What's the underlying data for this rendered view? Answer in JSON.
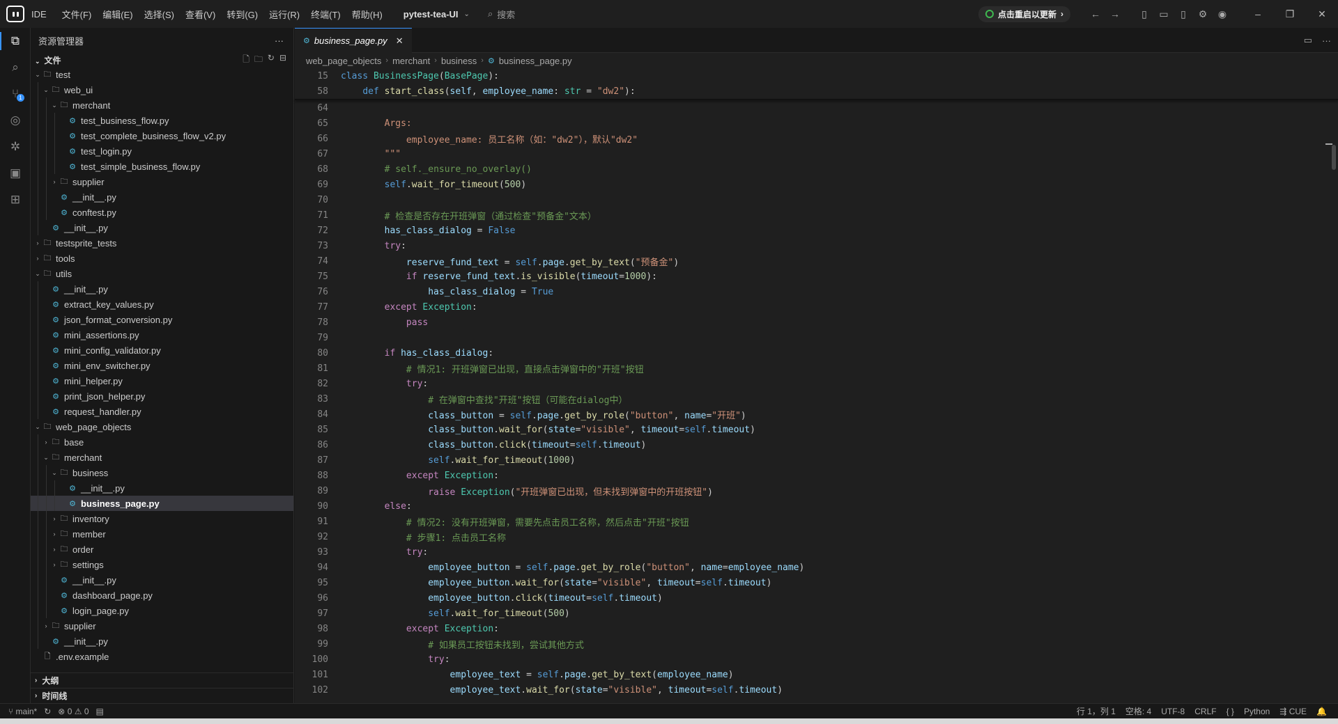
{
  "titlebar": {
    "app_name": "IDE",
    "menus": [
      "文件(F)",
      "编辑(E)",
      "选择(S)",
      "查看(V)",
      "转到(G)",
      "运行(R)",
      "终端(T)",
      "帮助(H)"
    ],
    "project": "pytest-tea-UI",
    "search_placeholder": "搜索",
    "restart_label": "点击重启以更新"
  },
  "sidebar": {
    "title": "资源管理器",
    "section": "文件",
    "tree": [
      {
        "label": "test",
        "depth": 0,
        "kind": "folder",
        "open": true
      },
      {
        "label": "web_ui",
        "depth": 1,
        "kind": "folder",
        "open": true
      },
      {
        "label": "merchant",
        "depth": 2,
        "kind": "folder",
        "open": true
      },
      {
        "label": "test_business_flow.py",
        "depth": 3,
        "kind": "py"
      },
      {
        "label": "test_complete_business_flow_v2.py",
        "depth": 3,
        "kind": "py"
      },
      {
        "label": "test_login.py",
        "depth": 3,
        "kind": "py"
      },
      {
        "label": "test_simple_business_flow.py",
        "depth": 3,
        "kind": "py"
      },
      {
        "label": "supplier",
        "depth": 2,
        "kind": "folder",
        "open": false
      },
      {
        "label": "__init__.py",
        "depth": 2,
        "kind": "py"
      },
      {
        "label": "conftest.py",
        "depth": 2,
        "kind": "py"
      },
      {
        "label": "__init__.py",
        "depth": 1,
        "kind": "py"
      },
      {
        "label": "testsprite_tests",
        "depth": 0,
        "kind": "folder",
        "open": false
      },
      {
        "label": "tools",
        "depth": 0,
        "kind": "folder",
        "open": false
      },
      {
        "label": "utils",
        "depth": 0,
        "kind": "folder",
        "open": true
      },
      {
        "label": "__init__.py",
        "depth": 1,
        "kind": "py"
      },
      {
        "label": "extract_key_values.py",
        "depth": 1,
        "kind": "py"
      },
      {
        "label": "json_format_conversion.py",
        "depth": 1,
        "kind": "py"
      },
      {
        "label": "mini_assertions.py",
        "depth": 1,
        "kind": "py"
      },
      {
        "label": "mini_config_validator.py",
        "depth": 1,
        "kind": "py"
      },
      {
        "label": "mini_env_switcher.py",
        "depth": 1,
        "kind": "py"
      },
      {
        "label": "mini_helper.py",
        "depth": 1,
        "kind": "py"
      },
      {
        "label": "print_json_helper.py",
        "depth": 1,
        "kind": "py"
      },
      {
        "label": "request_handler.py",
        "depth": 1,
        "kind": "py"
      },
      {
        "label": "web_page_objects",
        "depth": 0,
        "kind": "folder",
        "open": true
      },
      {
        "label": "base",
        "depth": 1,
        "kind": "folder",
        "open": false
      },
      {
        "label": "merchant",
        "depth": 1,
        "kind": "folder",
        "open": true
      },
      {
        "label": "business",
        "depth": 2,
        "kind": "folder",
        "open": true
      },
      {
        "label": "__init__.py",
        "depth": 3,
        "kind": "py"
      },
      {
        "label": "business_page.py",
        "depth": 3,
        "kind": "py",
        "selected": true
      },
      {
        "label": "inventory",
        "depth": 2,
        "kind": "folder",
        "open": false
      },
      {
        "label": "member",
        "depth": 2,
        "kind": "folder",
        "open": false
      },
      {
        "label": "order",
        "depth": 2,
        "kind": "folder",
        "open": false
      },
      {
        "label": "settings",
        "depth": 2,
        "kind": "folder",
        "open": false
      },
      {
        "label": "__init__.py",
        "depth": 2,
        "kind": "py"
      },
      {
        "label": "dashboard_page.py",
        "depth": 2,
        "kind": "py"
      },
      {
        "label": "login_page.py",
        "depth": 2,
        "kind": "py"
      },
      {
        "label": "supplier",
        "depth": 1,
        "kind": "folder",
        "open": false
      },
      {
        "label": "__init__.py",
        "depth": 1,
        "kind": "py"
      },
      {
        "label": ".env.example",
        "depth": 0,
        "kind": "file"
      }
    ],
    "outline_label": "大纲",
    "timeline_label": "时间线"
  },
  "editor": {
    "tab_label": "business_page.py",
    "breadcrumbs": [
      "web_page_objects",
      "merchant",
      "business",
      "business_page.py"
    ],
    "sticky": [
      {
        "n": "15",
        "html": "<span class='kb'>class</span> <span class='cl'>BusinessPage</span>(<span class='cl'>BasePage</span>):"
      },
      {
        "n": "58",
        "html": "    <span class='kb'>def</span> <span class='f'>start_class</span>(<span class='p'>self</span>, <span class='p'>employee_name</span>: <span class='cl'>str</span> = <span class='s2'>\"dw2\"</span>):"
      }
    ],
    "lines": [
      {
        "n": "64",
        "html": ""
      },
      {
        "n": "65",
        "html": "        <span class='s2'>Args:</span>"
      },
      {
        "n": "66",
        "html": "            <span class='s2'>employee_name: 员工名称（如：\"dw2\"），默认\"dw2\"</span>"
      },
      {
        "n": "67",
        "html": "        <span class='s2'>\"\"\"</span>"
      },
      {
        "n": "68",
        "html": "        <span class='cm'># self._ensure_no_overlay()</span>"
      },
      {
        "n": "69",
        "html": "        <span class='sf'>self</span>.<span class='f'>wait_for_timeout</span>(<span class='n'>500</span>)"
      },
      {
        "n": "70",
        "html": ""
      },
      {
        "n": "71",
        "html": "        <span class='cm'># 检查是否存在开班弹窗（通过检查\"预备金\"文本）</span>"
      },
      {
        "n": "72",
        "html": "        <span class='p'>has_class_dialog</span> = <span class='kb'>False</span>"
      },
      {
        "n": "73",
        "html": "        <span class='k'>try</span>:"
      },
      {
        "n": "74",
        "html": "            <span class='p'>reserve_fund_text</span> = <span class='sf'>self</span>.<span class='p'>page</span>.<span class='f'>get_by_text</span>(<span class='s2'>\"预备金\"</span>)"
      },
      {
        "n": "75",
        "html": "            <span class='k'>if</span> <span class='p'>reserve_fund_text</span>.<span class='f'>is_visible</span>(<span class='p'>timeout</span>=<span class='n'>1000</span>):"
      },
      {
        "n": "76",
        "html": "                <span class='p'>has_class_dialog</span> = <span class='kb'>True</span>"
      },
      {
        "n": "77",
        "html": "        <span class='k'>except</span> <span class='cl'>Exception</span>:"
      },
      {
        "n": "78",
        "html": "            <span class='k'>pass</span>"
      },
      {
        "n": "79",
        "html": ""
      },
      {
        "n": "80",
        "html": "        <span class='k'>if</span> <span class='p'>has_class_dialog</span>:"
      },
      {
        "n": "81",
        "html": "            <span class='cm'># 情况1: 开班弹窗已出现，直接点击弹窗中的\"开班\"按钮</span>"
      },
      {
        "n": "82",
        "html": "            <span class='k'>try</span>:"
      },
      {
        "n": "83",
        "html": "                <span class='cm'># 在弹窗中查找\"开班\"按钮（可能在dialog中）</span>"
      },
      {
        "n": "84",
        "html": "                <span class='p'>class_button</span> = <span class='sf'>self</span>.<span class='p'>page</span>.<span class='f'>get_by_role</span>(<span class='s2'>\"button\"</span>, <span class='p'>name</span>=<span class='s2'>\"开班\"</span>)"
      },
      {
        "n": "85",
        "html": "                <span class='p'>class_button</span>.<span class='f'>wait_for</span>(<span class='p'>state</span>=<span class='s2'>\"visible\"</span>, <span class='p'>timeout</span>=<span class='sf'>self</span>.<span class='p'>timeout</span>)"
      },
      {
        "n": "86",
        "html": "                <span class='p'>class_button</span>.<span class='f'>click</span>(<span class='p'>timeout</span>=<span class='sf'>self</span>.<span class='p'>timeout</span>)"
      },
      {
        "n": "87",
        "html": "                <span class='sf'>self</span>.<span class='f'>wait_for_timeout</span>(<span class='n'>1000</span>)"
      },
      {
        "n": "88",
        "html": "            <span class='k'>except</span> <span class='cl'>Exception</span>:"
      },
      {
        "n": "89",
        "html": "                <span class='k'>raise</span> <span class='cl'>Exception</span>(<span class='s2'>\"开班弹窗已出现，但未找到弹窗中的开班按钮\"</span>)"
      },
      {
        "n": "90",
        "html": "        <span class='k'>else</span>:"
      },
      {
        "n": "91",
        "html": "            <span class='cm'># 情况2: 没有开班弹窗，需要先点击员工名称，然后点击\"开班\"按钮</span>"
      },
      {
        "n": "92",
        "html": "            <span class='cm'># 步骤1: 点击员工名称</span>"
      },
      {
        "n": "93",
        "html": "            <span class='k'>try</span>:"
      },
      {
        "n": "94",
        "html": "                <span class='p'>employee_button</span> = <span class='sf'>self</span>.<span class='p'>page</span>.<span class='f'>get_by_role</span>(<span class='s2'>\"button\"</span>, <span class='p'>name</span>=<span class='p'>employee_name</span>)"
      },
      {
        "n": "95",
        "html": "                <span class='p'>employee_button</span>.<span class='f'>wait_for</span>(<span class='p'>state</span>=<span class='s2'>\"visible\"</span>, <span class='p'>timeout</span>=<span class='sf'>self</span>.<span class='p'>timeout</span>)"
      },
      {
        "n": "96",
        "html": "                <span class='p'>employee_button</span>.<span class='f'>click</span>(<span class='p'>timeout</span>=<span class='sf'>self</span>.<span class='p'>timeout</span>)"
      },
      {
        "n": "97",
        "html": "                <span class='sf'>self</span>.<span class='f'>wait_for_timeout</span>(<span class='n'>500</span>)"
      },
      {
        "n": "98",
        "html": "            <span class='k'>except</span> <span class='cl'>Exception</span>:"
      },
      {
        "n": "99",
        "html": "                <span class='cm'># 如果员工按钮未找到，尝试其他方式</span>"
      },
      {
        "n": "100",
        "html": "                <span class='k'>try</span>:"
      },
      {
        "n": "101",
        "html": "                    <span class='p'>employee_text</span> = <span class='sf'>self</span>.<span class='p'>page</span>.<span class='f'>get_by_text</span>(<span class='p'>employee_name</span>)"
      },
      {
        "n": "102",
        "html": "                    <span class='p'>employee_text</span>.<span class='f'>wait_for</span>(<span class='p'>state</span>=<span class='s2'>\"visible\"</span>, <span class='p'>timeout</span>=<span class='sf'>self</span>.<span class='p'>timeout</span>)"
      }
    ]
  },
  "statusbar": {
    "branch": "main*",
    "errors": "0",
    "warnings": "0",
    "position": "行 1，列 1",
    "spaces": "空格: 4",
    "encoding": "UTF-8",
    "eol": "CRLF",
    "braces": "{ }",
    "language": "Python",
    "cue": "CUE"
  }
}
